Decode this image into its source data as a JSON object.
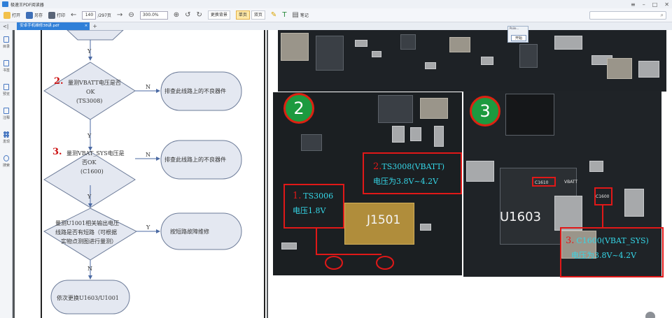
{
  "window": {
    "title": "极速王PDF阅读器"
  },
  "toolbar": {
    "open": "打开",
    "save": "另存",
    "print": "打印",
    "page_current": "140",
    "page_total": "/297页",
    "zoom": "300.0%",
    "background": "更换背景",
    "single_page": "单页",
    "double_page": "双页",
    "note": "笔记",
    "search_placeholder": ""
  },
  "tabs": [
    {
      "label": "安卓手机维修38讲.pdf"
    }
  ],
  "sidebar": {
    "items": [
      {
        "label": "目录",
        "icon": "toc-icon"
      },
      {
        "label": "书签",
        "icon": "bookmark-icon"
      },
      {
        "label": "预览",
        "icon": "preview-icon"
      },
      {
        "label": "注释",
        "icon": "annotation-icon"
      },
      {
        "label": "发现",
        "icon": "discover-icon"
      },
      {
        "label": "搜索",
        "icon": "search-icon"
      }
    ]
  },
  "flowchart": {
    "steps": [
      {
        "num": "2.",
        "lines": [
          "量测VBATT电压是否",
          "OK",
          "(TS3008)"
        ]
      },
      {
        "num": "3.",
        "lines": [
          "量测VBAT_SYS电压是",
          "否OK",
          "(C1600)"
        ]
      },
      {
        "num": "",
        "lines": [
          "量测U1001相关输出电压",
          "线路是否有短路（可根据",
          "实物点测图进行量测）"
        ]
      }
    ],
    "outcomes": [
      "排查此线路上的不良器件",
      "排查此线路上的不良器件",
      "按短路故障维修"
    ],
    "final": "依次更换U1603/U1001",
    "labels": {
      "yes": "Y",
      "no": "N"
    }
  },
  "board": {
    "markers": [
      "2",
      "3"
    ],
    "annotations": [
      {
        "num": "1.",
        "lines": [
          "TS3006",
          "电压1.8V"
        ]
      },
      {
        "num": "2.",
        "lines": [
          "TS3008(VBATT)",
          "电压为3.8V~4.2V"
        ]
      },
      {
        "num": "3.",
        "lines": [
          "C1600(VBAT_SYS)",
          "电压为3.8V~4.2V"
        ]
      }
    ],
    "chips": {
      "j1501": "J1501",
      "u1603": "U1603",
      "c1610": "C1610",
      "vbatt": "VBATT",
      "c1600": "C1600"
    }
  },
  "popup": {
    "title": "Poile...",
    "button": "开始"
  }
}
